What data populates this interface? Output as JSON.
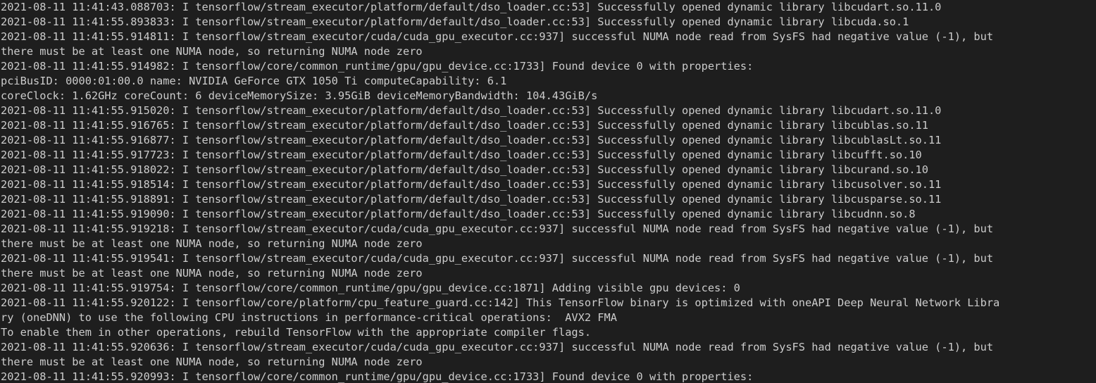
{
  "terminal": {
    "lines": [
      "2021-08-11 11:41:43.088703: I tensorflow/stream_executor/platform/default/dso_loader.cc:53] Successfully opened dynamic library libcudart.so.11.0",
      "2021-08-11 11:41:55.893833: I tensorflow/stream_executor/platform/default/dso_loader.cc:53] Successfully opened dynamic library libcuda.so.1",
      "2021-08-11 11:41:55.914811: I tensorflow/stream_executor/cuda/cuda_gpu_executor.cc:937] successful NUMA node read from SysFS had negative value (-1), but",
      "there must be at least one NUMA node, so returning NUMA node zero",
      "2021-08-11 11:41:55.914982: I tensorflow/core/common_runtime/gpu/gpu_device.cc:1733] Found device 0 with properties:",
      "pciBusID: 0000:01:00.0 name: NVIDIA GeForce GTX 1050 Ti computeCapability: 6.1",
      "coreClock: 1.62GHz coreCount: 6 deviceMemorySize: 3.95GiB deviceMemoryBandwidth: 104.43GiB/s",
      "2021-08-11 11:41:55.915020: I tensorflow/stream_executor/platform/default/dso_loader.cc:53] Successfully opened dynamic library libcudart.so.11.0",
      "2021-08-11 11:41:55.916765: I tensorflow/stream_executor/platform/default/dso_loader.cc:53] Successfully opened dynamic library libcublas.so.11",
      "2021-08-11 11:41:55.916877: I tensorflow/stream_executor/platform/default/dso_loader.cc:53] Successfully opened dynamic library libcublasLt.so.11",
      "2021-08-11 11:41:55.917723: I tensorflow/stream_executor/platform/default/dso_loader.cc:53] Successfully opened dynamic library libcufft.so.10",
      "2021-08-11 11:41:55.918022: I tensorflow/stream_executor/platform/default/dso_loader.cc:53] Successfully opened dynamic library libcurand.so.10",
      "2021-08-11 11:41:55.918514: I tensorflow/stream_executor/platform/default/dso_loader.cc:53] Successfully opened dynamic library libcusolver.so.11",
      "2021-08-11 11:41:55.918891: I tensorflow/stream_executor/platform/default/dso_loader.cc:53] Successfully opened dynamic library libcusparse.so.11",
      "2021-08-11 11:41:55.919090: I tensorflow/stream_executor/platform/default/dso_loader.cc:53] Successfully opened dynamic library libcudnn.so.8",
      "2021-08-11 11:41:55.919218: I tensorflow/stream_executor/cuda/cuda_gpu_executor.cc:937] successful NUMA node read from SysFS had negative value (-1), but",
      "there must be at least one NUMA node, so returning NUMA node zero",
      "2021-08-11 11:41:55.919541: I tensorflow/stream_executor/cuda/cuda_gpu_executor.cc:937] successful NUMA node read from SysFS had negative value (-1), but",
      "there must be at least one NUMA node, so returning NUMA node zero",
      "2021-08-11 11:41:55.919754: I tensorflow/core/common_runtime/gpu/gpu_device.cc:1871] Adding visible gpu devices: 0",
      "2021-08-11 11:41:55.920122: I tensorflow/core/platform/cpu_feature_guard.cc:142] This TensorFlow binary is optimized with oneAPI Deep Neural Network Libra",
      "ry (oneDNN) to use the following CPU instructions in performance-critical operations:  AVX2 FMA",
      "To enable them in other operations, rebuild TensorFlow with the appropriate compiler flags.",
      "2021-08-11 11:41:55.920636: I tensorflow/stream_executor/cuda/cuda_gpu_executor.cc:937] successful NUMA node read from SysFS had negative value (-1), but",
      "there must be at least one NUMA node, so returning NUMA node zero",
      "2021-08-11 11:41:55.920993: I tensorflow/core/common_runtime/gpu/gpu_device.cc:1733] Found device 0 with properties:"
    ]
  },
  "colors": {
    "background": "#1e1e1e",
    "foreground": "#cccccc"
  }
}
